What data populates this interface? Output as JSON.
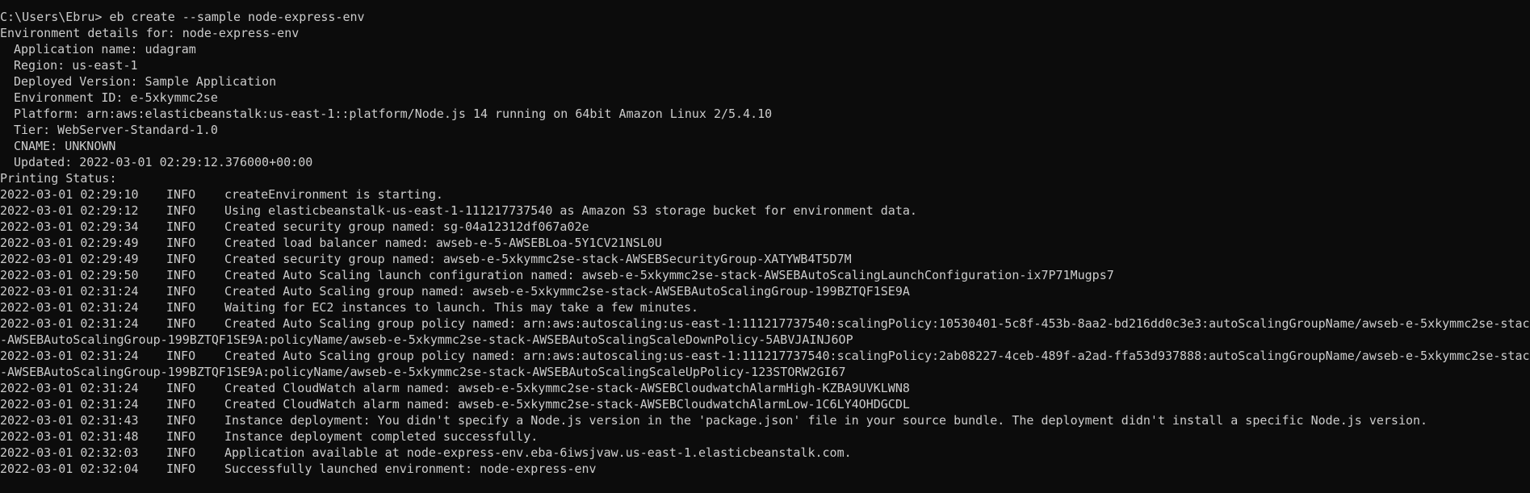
{
  "prompt": {
    "text": "C:\\Users\\Ebru> eb create --sample node-express-env"
  },
  "details": {
    "header": "Environment details for: node-express-env",
    "application_name": "Application name: udagram",
    "region": "Region: us-east-1",
    "deployed_version": "Deployed Version: Sample Application",
    "environment_id": "Environment ID: e-5xkymmc2se",
    "platform": "Platform: arn:aws:elasticbeanstalk:us-east-1::platform/Node.js 14 running on 64bit Amazon Linux 2/5.4.10",
    "tier": "Tier: WebServer-Standard-1.0",
    "cname": "CNAME: UNKNOWN",
    "updated": "Updated: 2022-03-01 02:29:12.376000+00:00"
  },
  "status_header": "Printing Status:",
  "log": [
    {
      "ts": "2022-03-01 02:29:10",
      "level": "INFO",
      "msg": "createEnvironment is starting."
    },
    {
      "ts": "2022-03-01 02:29:12",
      "level": "INFO",
      "msg": "Using elasticbeanstalk-us-east-1-111217737540 as Amazon S3 storage bucket for environment data."
    },
    {
      "ts": "2022-03-01 02:29:34",
      "level": "INFO",
      "msg": "Created security group named: sg-04a12312df067a02e"
    },
    {
      "ts": "2022-03-01 02:29:49",
      "level": "INFO",
      "msg": "Created load balancer named: awseb-e-5-AWSEBLoa-5Y1CV21NSL0U"
    },
    {
      "ts": "2022-03-01 02:29:49",
      "level": "INFO",
      "msg": "Created security group named: awseb-e-5xkymmc2se-stack-AWSEBSecurityGroup-XATYWB4T5D7M"
    },
    {
      "ts": "2022-03-01 02:29:50",
      "level": "INFO",
      "msg": "Created Auto Scaling launch configuration named: awseb-e-5xkymmc2se-stack-AWSEBAutoScalingLaunchConfiguration-ix7P71Mugps7"
    },
    {
      "ts": "2022-03-01 02:31:24",
      "level": "INFO",
      "msg": "Created Auto Scaling group named: awseb-e-5xkymmc2se-stack-AWSEBAutoScalingGroup-199BZTQF1SE9A"
    },
    {
      "ts": "2022-03-01 02:31:24",
      "level": "INFO",
      "msg": "Waiting for EC2 instances to launch. This may take a few minutes."
    },
    {
      "ts": "2022-03-01 02:31:24",
      "level": "INFO",
      "msg": "Created Auto Scaling group policy named: arn:aws:autoscaling:us-east-1:111217737540:scalingPolicy:10530401-5c8f-453b-8aa2-bd216dd0c3e3:autoScalingGroupName/awseb-e-5xkymmc2se-stack"
    },
    {
      "ts": "",
      "level": "",
      "msg": "-AWSEBAutoScalingGroup-199BZTQF1SE9A:policyName/awseb-e-5xkymmc2se-stack-AWSEBAutoScalingScaleDownPolicy-5ABVJAINJ6OP",
      "continuation": true
    },
    {
      "ts": "2022-03-01 02:31:24",
      "level": "INFO",
      "msg": "Created Auto Scaling group policy named: arn:aws:autoscaling:us-east-1:111217737540:scalingPolicy:2ab08227-4ceb-489f-a2ad-ffa53d937888:autoScalingGroupName/awseb-e-5xkymmc2se-stack"
    },
    {
      "ts": "",
      "level": "",
      "msg": "-AWSEBAutoScalingGroup-199BZTQF1SE9A:policyName/awseb-e-5xkymmc2se-stack-AWSEBAutoScalingScaleUpPolicy-123STORW2GI67",
      "continuation": true
    },
    {
      "ts": "2022-03-01 02:31:24",
      "level": "INFO",
      "msg": "Created CloudWatch alarm named: awseb-e-5xkymmc2se-stack-AWSEBCloudwatchAlarmHigh-KZBA9UVKLWN8"
    },
    {
      "ts": "2022-03-01 02:31:24",
      "level": "INFO",
      "msg": "Created CloudWatch alarm named: awseb-e-5xkymmc2se-stack-AWSEBCloudwatchAlarmLow-1C6LY4OHDGCDL"
    },
    {
      "ts": "2022-03-01 02:31:43",
      "level": "INFO",
      "msg": "Instance deployment: You didn't specify a Node.js version in the 'package.json' file in your source bundle. The deployment didn't install a specific Node.js version."
    },
    {
      "ts": "2022-03-01 02:31:48",
      "level": "INFO",
      "msg": "Instance deployment completed successfully."
    },
    {
      "ts": "2022-03-01 02:32:03",
      "level": "INFO",
      "msg": "Application available at node-express-env.eba-6iwsjvaw.us-east-1.elasticbeanstalk.com."
    },
    {
      "ts": "2022-03-01 02:32:04",
      "level": "INFO",
      "msg": "Successfully launched environment: node-express-env"
    }
  ],
  "colors": {
    "background": "#0c0c0c",
    "text": "#cccccc"
  }
}
